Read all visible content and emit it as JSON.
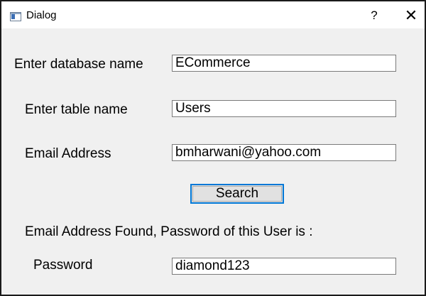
{
  "window": {
    "title": "Dialog",
    "help_label": "?",
    "close_label": "✕"
  },
  "form": {
    "database": {
      "label": "Enter database name",
      "value": "ECommerce"
    },
    "table": {
      "label": "Enter table name",
      "value": "Users"
    },
    "email": {
      "label": "Email Address",
      "value": "bmharwani@yahoo.com"
    },
    "search_label": "Search",
    "result_message": "Email Address Found, Password of this User is :",
    "password": {
      "label": "Password",
      "value": "diamond123"
    }
  },
  "colors": {
    "focus_border": "#0078d7",
    "dialog_background": "#f0f0f0",
    "titlebar_background": "#ffffff"
  },
  "icons": {
    "app": "window-app-icon",
    "help": "question-mark",
    "close": "close-x"
  }
}
